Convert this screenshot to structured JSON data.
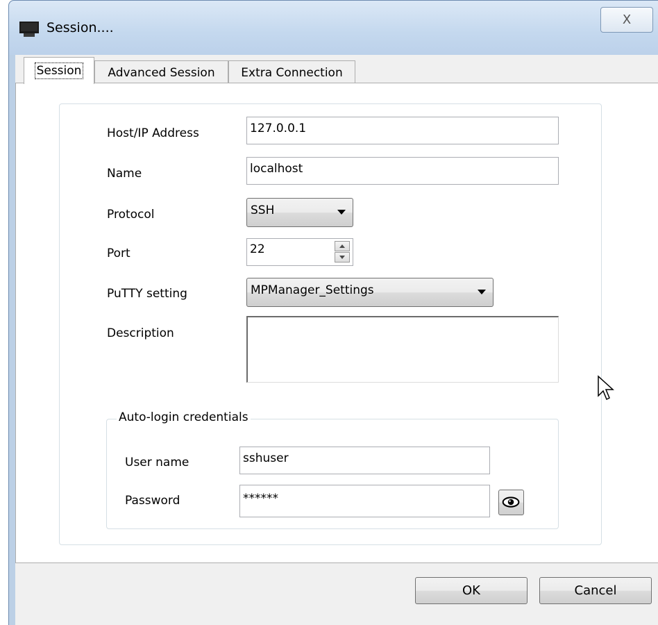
{
  "window": {
    "title": "Session....",
    "close_glyph": "X"
  },
  "tabs": [
    {
      "label": "Session",
      "active": true
    },
    {
      "label": "Advanced Session",
      "active": false
    },
    {
      "label": "Extra Connection",
      "active": false
    }
  ],
  "form": {
    "host": {
      "label": "Host/IP Address",
      "value": "127.0.0.1"
    },
    "name": {
      "label": "Name",
      "value": "localhost"
    },
    "protocol": {
      "label": "Protocol",
      "value": "SSH"
    },
    "port": {
      "label": "Port",
      "value": "22"
    },
    "putty": {
      "label": "PuTTY setting",
      "value": "MPManager_Settings"
    },
    "description": {
      "label": "Description",
      "value": ""
    }
  },
  "credentials": {
    "legend": "Auto-login credentials",
    "username": {
      "label": "User name",
      "value": "sshuser"
    },
    "password": {
      "label": "Password",
      "value": "******"
    }
  },
  "buttons": {
    "ok": "OK",
    "cancel": "Cancel"
  },
  "icons": {
    "app": "terminal-icon",
    "reveal": "eye-icon",
    "cursor": "mouse-pointer-icon"
  }
}
